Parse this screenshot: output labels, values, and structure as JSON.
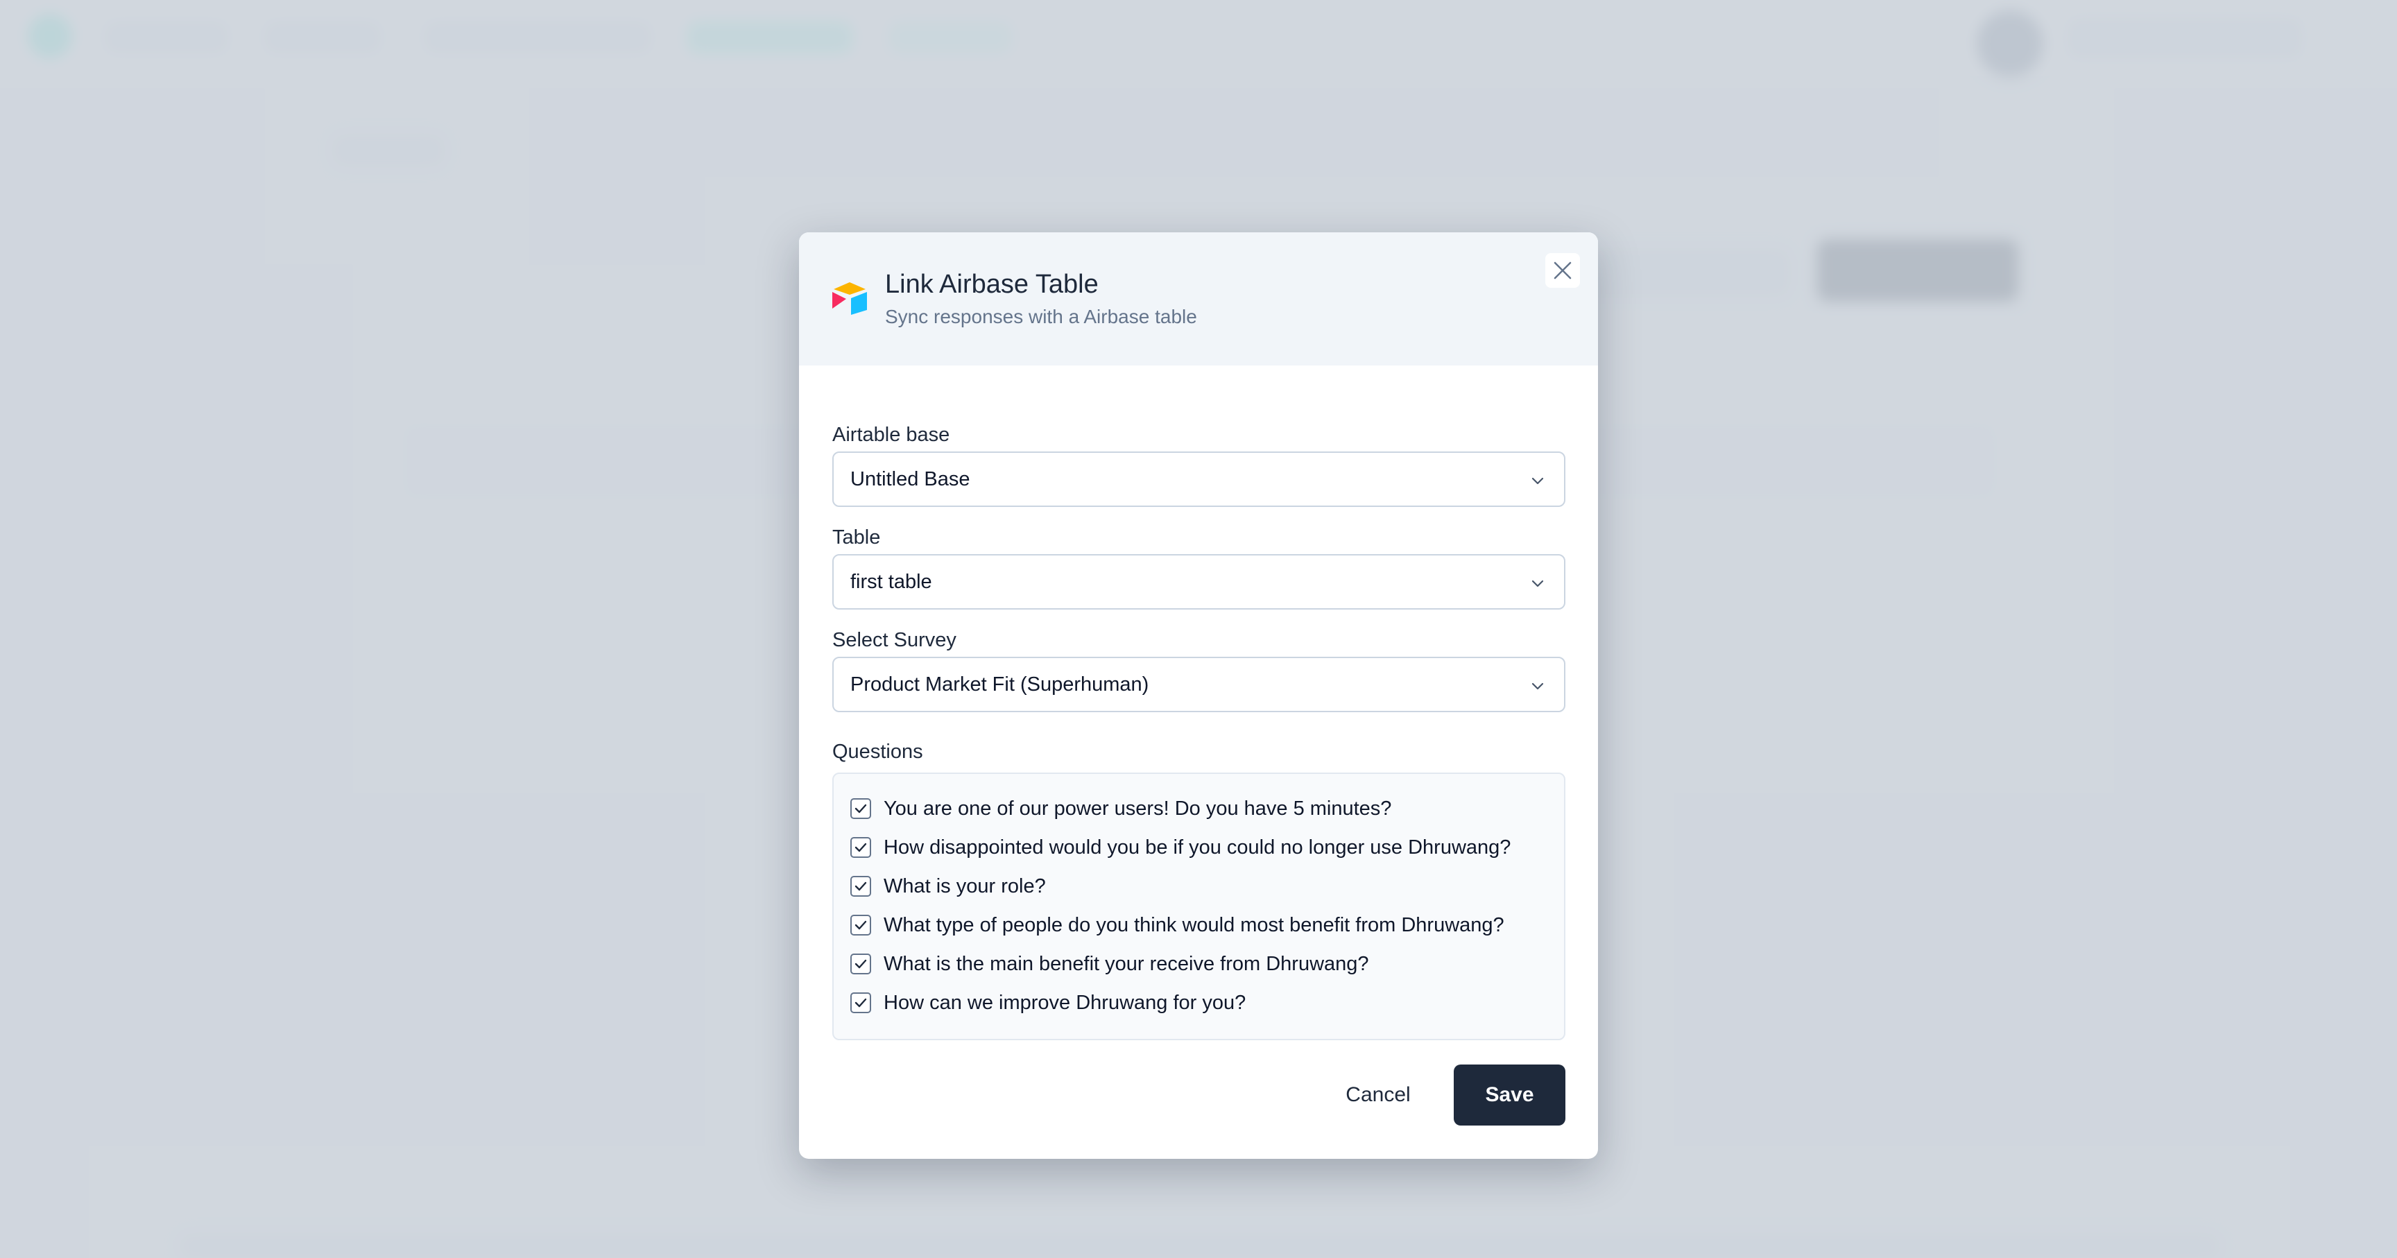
{
  "modal": {
    "title": "Link Airbase Table",
    "subtitle": "Sync responses with a Airbase table",
    "close_icon": "close-icon",
    "logo_icon": "airtable-logo"
  },
  "form": {
    "base_label": "Airtable base",
    "base_value": "Untitled Base",
    "table_label": "Table",
    "table_value": "first table",
    "survey_label": "Select Survey",
    "survey_value": "Product Market Fit (Superhuman)",
    "questions_label": "Questions",
    "questions": [
      {
        "text": "You are one of our power users! Do you have 5 minutes?",
        "checked": true
      },
      {
        "text": "How disappointed would you be if you could no longer use Dhruwang?",
        "checked": true
      },
      {
        "text": "What is your role?",
        "checked": true
      },
      {
        "text": "What type of people do you think would most benefit from Dhruwang?",
        "checked": true
      },
      {
        "text": "What is the main benefit your receive from Dhruwang?",
        "checked": true
      },
      {
        "text": "How can we improve Dhruwang for you?",
        "checked": true
      }
    ]
  },
  "actions": {
    "cancel_label": "Cancel",
    "save_label": "Save"
  },
  "colors": {
    "primary": "#1e293b",
    "header_bg": "#f1f5f9",
    "overlay": "#cbd1da"
  }
}
